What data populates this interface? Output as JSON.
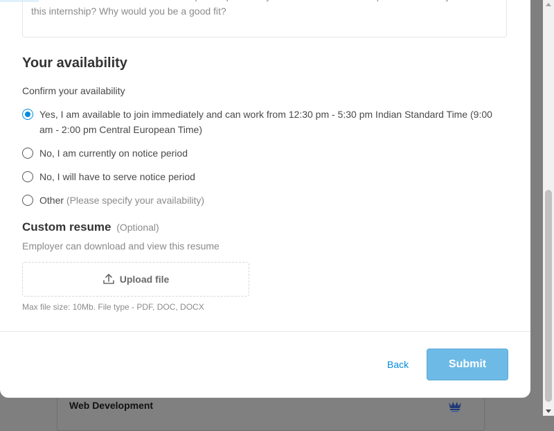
{
  "cover_letter": {
    "text": "Mention in detail what relevant skill or past experience you have for this internship. What excites you about this internship? Why would you be a good fit?"
  },
  "availability": {
    "title": "Your availability",
    "prompt": "Confirm your availability",
    "options": [
      {
        "label": "Yes, I am available to join immediately and can work from 12:30 pm - 5:30 pm Indian Standard Time (9:00 am - 2:00 pm Central European Time)",
        "hint": "",
        "selected": true
      },
      {
        "label": "No, I am currently on notice period",
        "hint": "",
        "selected": false
      },
      {
        "label": "No, I will have to serve notice period",
        "hint": "",
        "selected": false
      },
      {
        "label": "Other",
        "hint": "(Please specify your availability)",
        "selected": false
      }
    ]
  },
  "resume": {
    "title": "Custom resume",
    "optional": "(Optional)",
    "description": "Employer can download and view this resume",
    "upload_label": "Upload file",
    "constraints": "Max file size: 10Mb. File type - PDF, DOC, DOCX"
  },
  "footer": {
    "back_label": "Back",
    "submit_label": "Submit"
  },
  "background": {
    "card_title": "Web Development"
  },
  "colors": {
    "accent": "#008bdc",
    "submit_bg": "#6dbae6",
    "overlay": "#7f7f7f"
  },
  "icons": {
    "upload": "upload-icon"
  }
}
